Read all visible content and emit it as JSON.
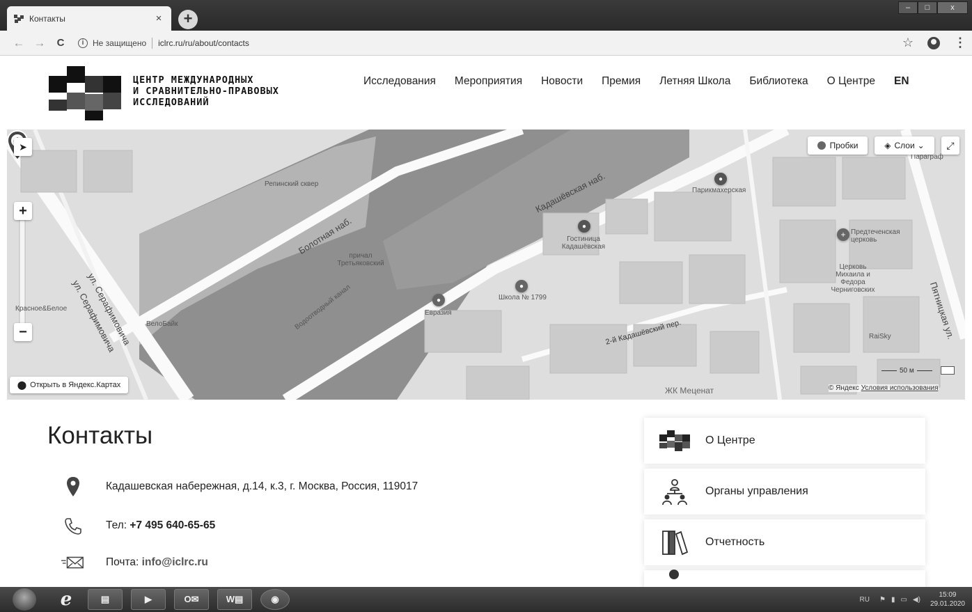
{
  "browser": {
    "tab_title": "Контакты",
    "tab_close": "×",
    "new_tab": "+",
    "window_controls": [
      "–",
      "□",
      "x"
    ],
    "back": "←",
    "forward": "→",
    "reload": "C",
    "security_label": "Не защищено",
    "url": "iclrc.ru/ru/about/contacts",
    "bookmark_star": "☆",
    "menu": "⋮"
  },
  "site": {
    "logo_lines": [
      "ЦЕНТР МЕЖДУНАРОДНЫХ",
      "И СРАВНИТЕЛЬНО-ПРАВОВЫХ",
      "ИССЛЕДОВАНИЙ"
    ],
    "nav": [
      "Исследования",
      "Мероприятия",
      "Новости",
      "Премия",
      "Летняя Школа",
      "Библиотека",
      "О Центре"
    ],
    "lang": "EN"
  },
  "map": {
    "traffic_button": "Пробки",
    "layers_button": "Слои",
    "zoom_in": "+",
    "zoom_out": "−",
    "open_in_yandex": "Открыть в Яндекс.Картах",
    "scale": "50 м",
    "copyright": "© Яндекс",
    "terms_link": "Условия использования",
    "streets": {
      "bolotnaya": "Болотная наб.",
      "kadashevskaya": "Кадашёвская наб.",
      "serafimovicha": "ул. Серафимовича",
      "serafimovicha2": "ул. Серафимовича",
      "pyatnitskaya": "Пятницкая ул.",
      "kanal": "Водоотводный канал",
      "kadashevsky_per": "2-й Кадашёвский пер."
    },
    "places": {
      "repin_square": "Репинский сквер",
      "pier": "причал Третьяковский",
      "hotel": "Гостиница Кадашёвская",
      "school": "Школа № 1799",
      "hairdresser": "Парикмахерская",
      "church1": "Предтеченская церковь",
      "church2": "Церковь Михаила и Федора Черниговских",
      "bike": "ВелоБайк",
      "eurasia": "Евразия",
      "mecenat": "ЖК Меценат",
      "paragraph": "Параграф",
      "raisky": "RaiSky",
      "krasnoe": "Красное&Белое"
    }
  },
  "contacts": {
    "title": "Контакты",
    "address": "Кадашевская набережная, д.14, к.3, г. Москва, Россия, 119017",
    "phone_label": "Тел:",
    "phone": "+7 495 640-65-65",
    "mail_label": "Почта:",
    "mail": "info@iclrc.ru"
  },
  "side_menu": [
    {
      "label": "О Центре",
      "icon": "logo-icon"
    },
    {
      "label": "Органы управления",
      "icon": "org-structure-icon"
    },
    {
      "label": "Отчетность",
      "icon": "books-icon"
    }
  ],
  "taskbar": {
    "lang": "RU",
    "time": "15:09",
    "date": "29.01.2020"
  }
}
